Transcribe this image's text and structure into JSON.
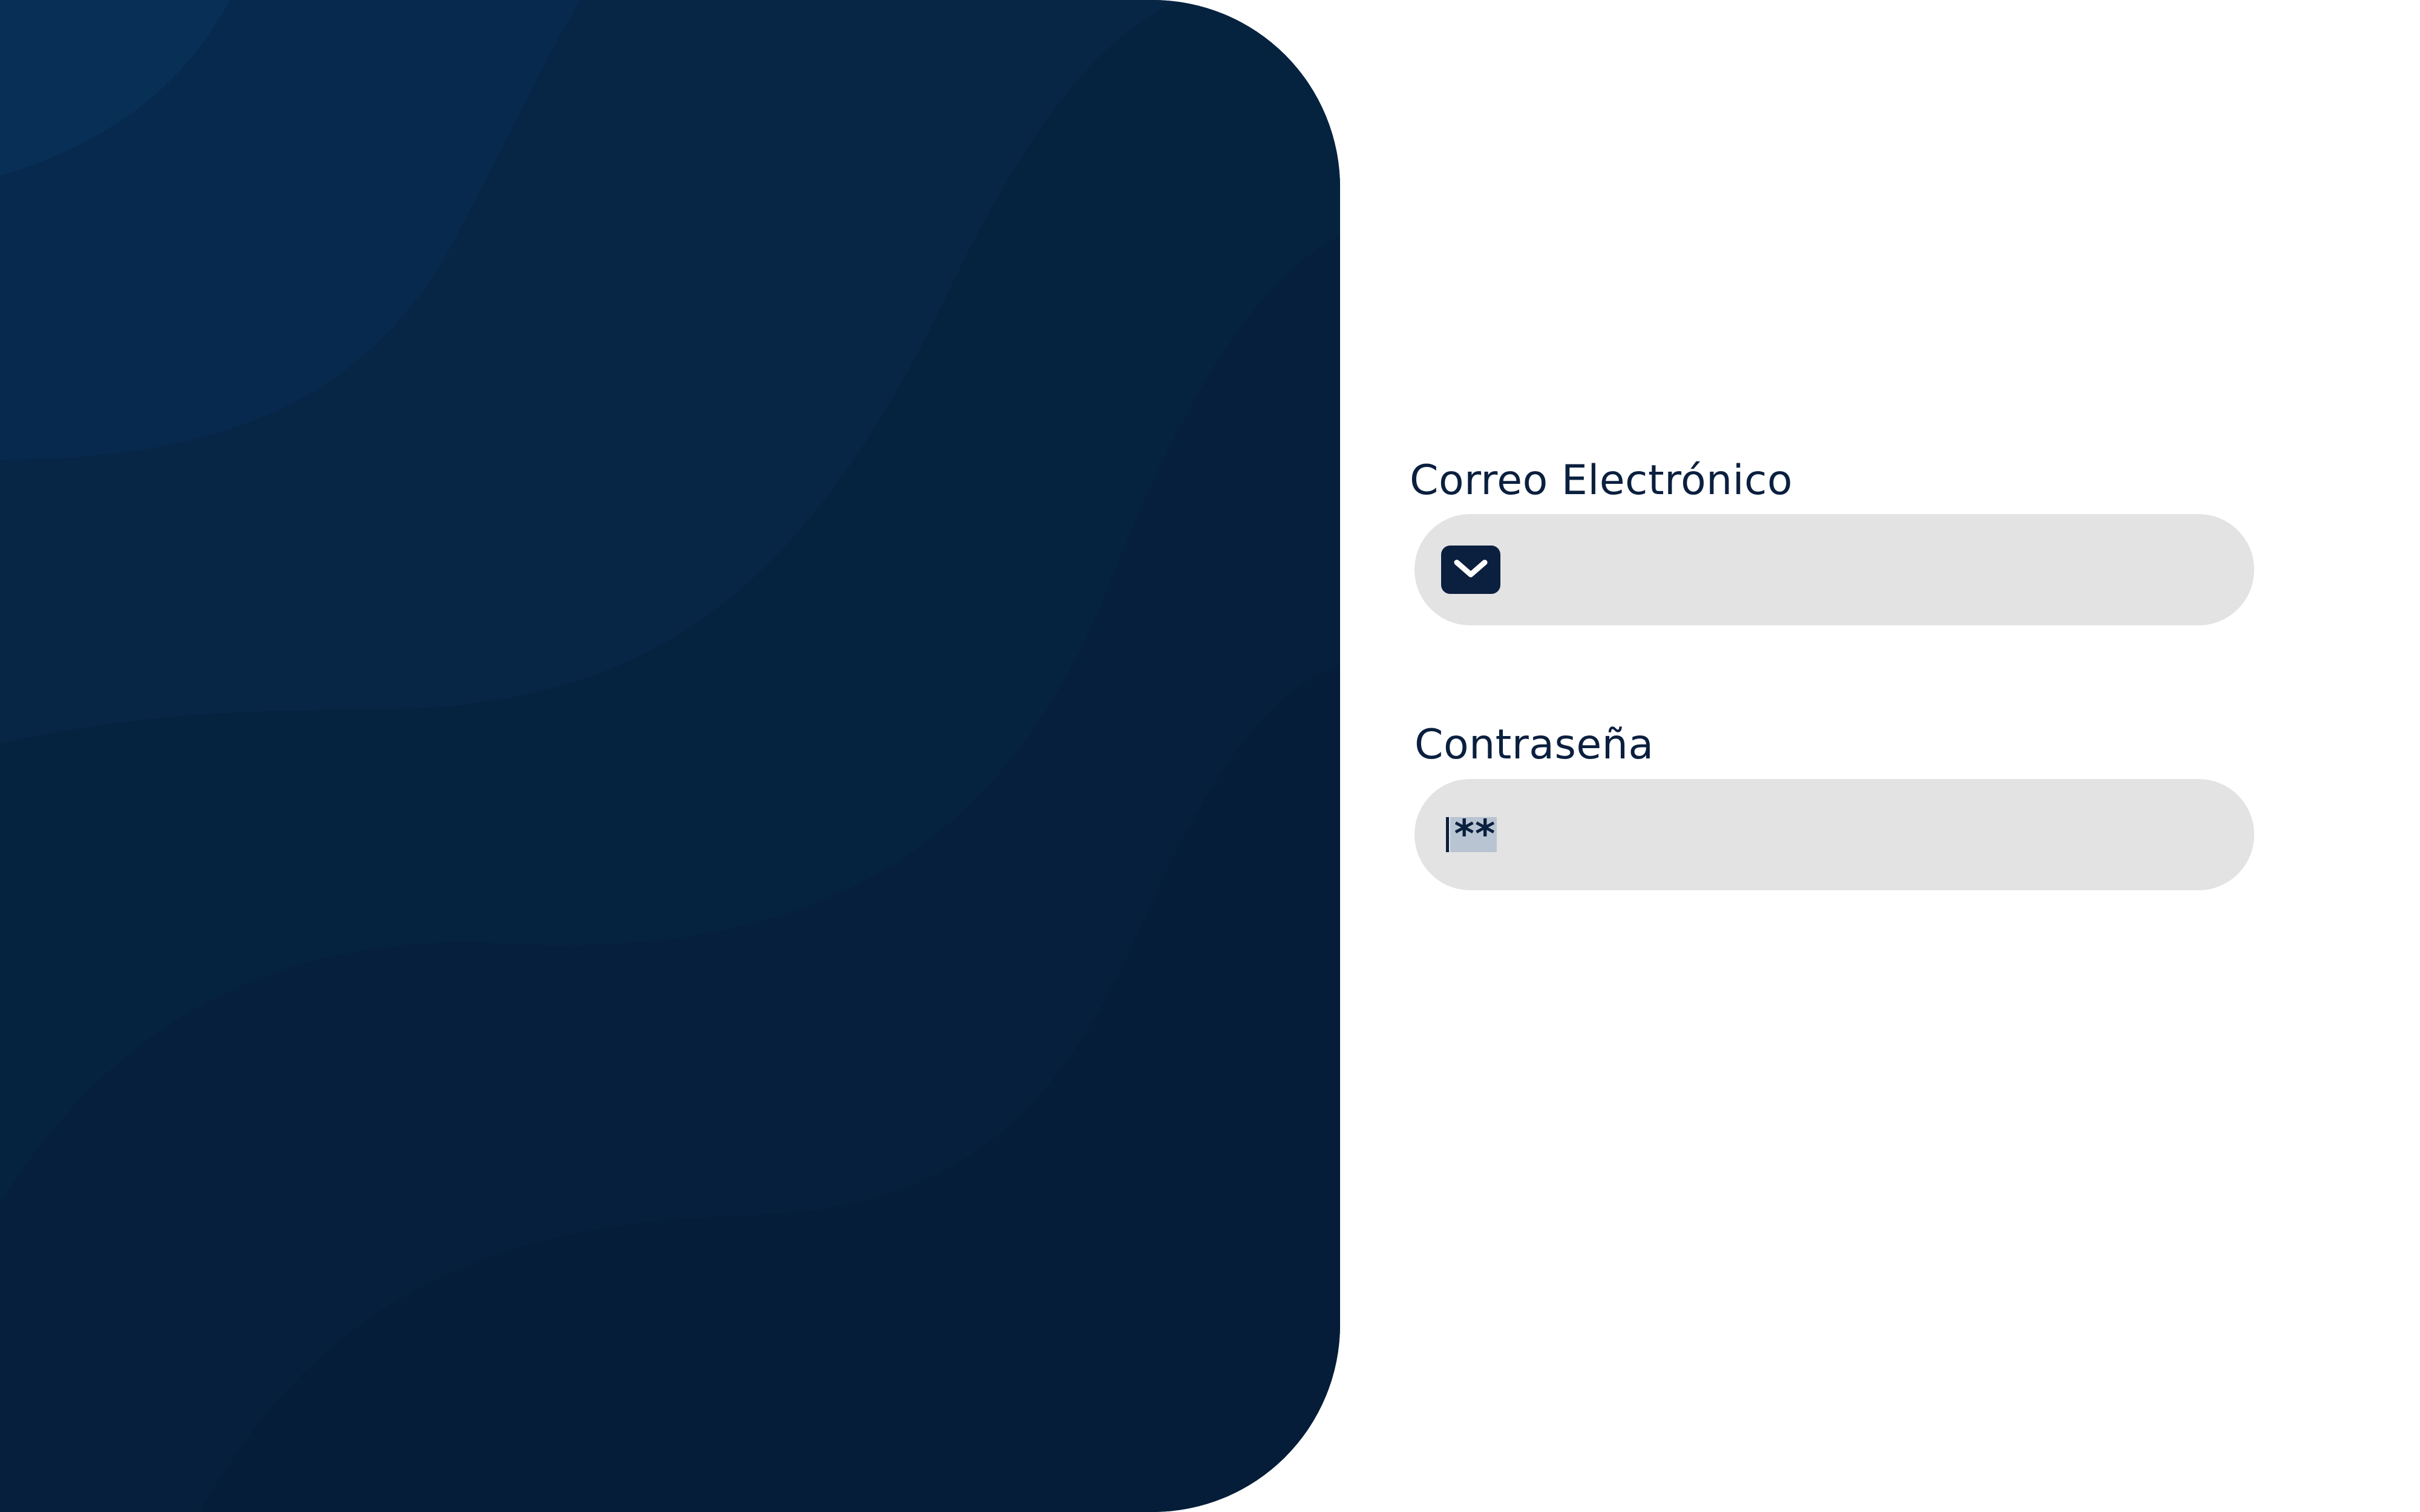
{
  "login_form": {
    "email": {
      "label": "Correo Electrónico",
      "value": "",
      "icon": "mail-icon"
    },
    "password": {
      "label": "Contraseña",
      "masked_value": "**"
    }
  },
  "colors": {
    "panel_dark": "#061f3c",
    "panel_wave_light": "#082a4f",
    "text_primary": "#0b1f3e",
    "field_bg": "#e3e3e3",
    "selection_bg": "#b9c4d2",
    "page_bg": "#ffffff"
  }
}
